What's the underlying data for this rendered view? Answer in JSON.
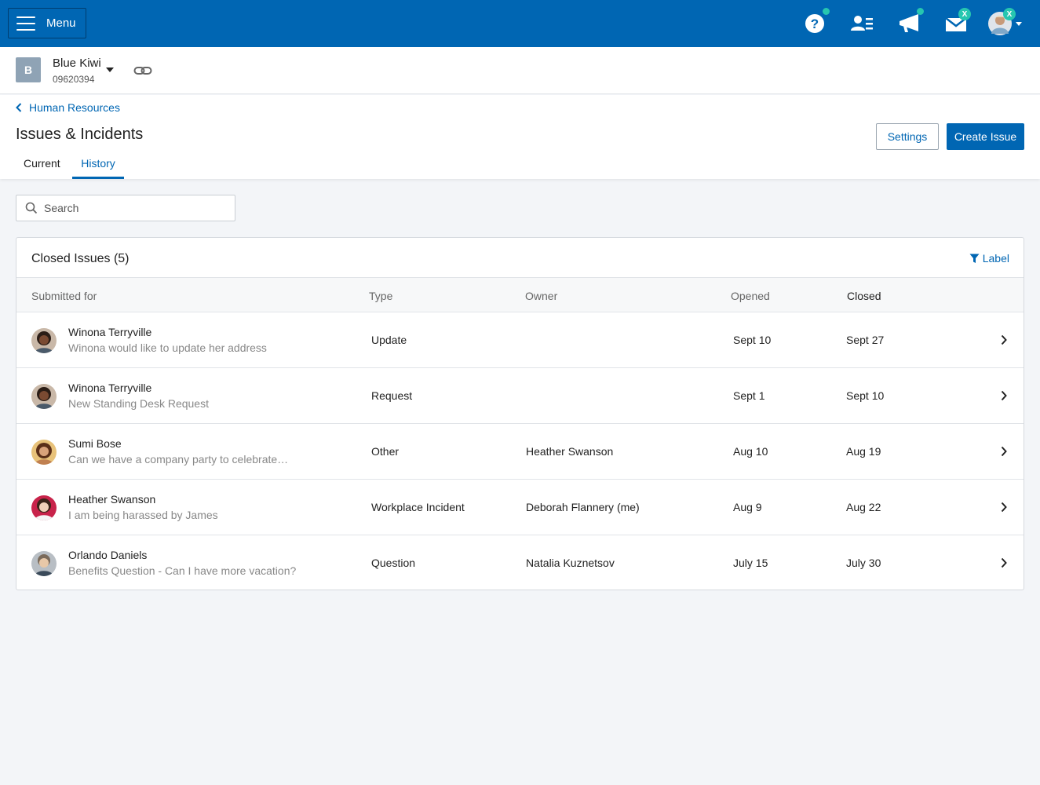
{
  "topbar": {
    "menu_label": "Menu",
    "icons": [
      "help-icon",
      "people-icon",
      "announcement-icon",
      "inbox-icon",
      "user-avatar"
    ],
    "inbox_badge": "X",
    "avatar_badge": "X"
  },
  "company": {
    "initial": "B",
    "name": "Blue Kiwi",
    "id": "09620394"
  },
  "page": {
    "breadcrumb": "Human Resources",
    "title": "Issues & Incidents",
    "tabs": [
      {
        "label": "Current",
        "active": false
      },
      {
        "label": "History",
        "active": true
      }
    ],
    "settings_label": "Settings",
    "create_label": "Create Issue"
  },
  "search": {
    "placeholder": "Search"
  },
  "table": {
    "title": "Closed Issues (5)",
    "filter_label": "Label",
    "columns": [
      "Submitted for",
      "Type",
      "Owner",
      "Opened",
      "Closed"
    ],
    "rows": [
      {
        "name": "Winona Terryville",
        "desc": "Winona would like to update her address",
        "type": "Update",
        "owner": "",
        "opened": "Sept 10",
        "closed": "Sept 27"
      },
      {
        "name": "Winona Terryville",
        "desc": "New Standing Desk Request",
        "type": "Request",
        "owner": "",
        "opened": "Sept 1",
        "closed": "Sept 10"
      },
      {
        "name": "Sumi Bose",
        "desc": "Can we have a company party to celebrate…",
        "type": "Other",
        "owner": "Heather Swanson",
        "opened": "Aug 10",
        "closed": "Aug 19"
      },
      {
        "name": "Heather Swanson",
        "desc": "I am being harassed by James",
        "type": "Workplace Incident",
        "owner": "Deborah Flannery (me)",
        "opened": "Aug 9",
        "closed": "Aug 22"
      },
      {
        "name": "Orlando Daniels",
        "desc": "Benefits Question - Can I have more vacation?",
        "type": "Question",
        "owner": "Natalia Kuznetsov",
        "opened": "July 15",
        "closed": "July 30"
      }
    ]
  },
  "colors": {
    "brand": "#0066b3",
    "accent": "#26c6b0",
    "background": "#f3f5f8"
  }
}
